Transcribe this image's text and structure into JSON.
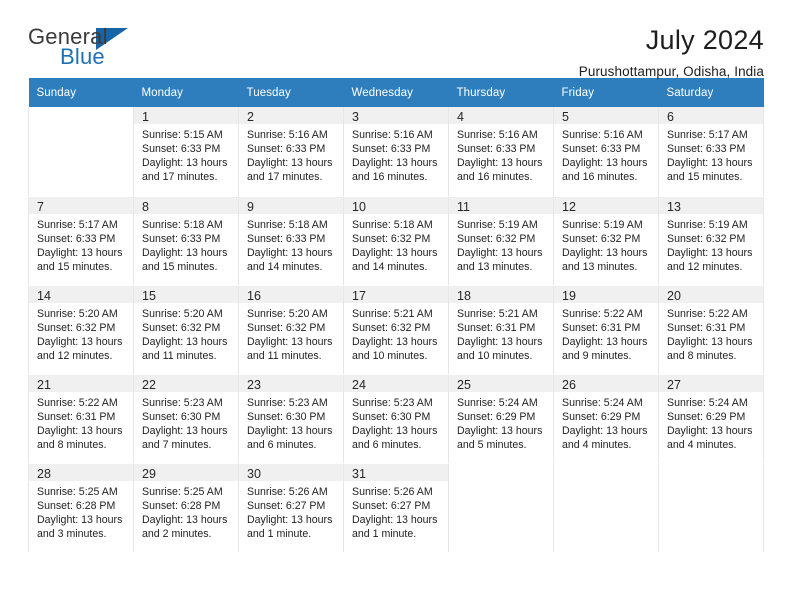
{
  "brand": {
    "word_one": "General",
    "word_two": "Blue",
    "triangle_color": "#1565a8",
    "blue_color": "#1c72b8"
  },
  "header": {
    "title": "July 2024",
    "subtitle": "Purushottampur, Odisha, India",
    "header_bg": "#2e7ebe",
    "header_text_color": "#ffffff"
  },
  "calendar": {
    "weekday_headers": [
      "Sunday",
      "Monday",
      "Tuesday",
      "Wednesday",
      "Thursday",
      "Friday",
      "Saturday"
    ],
    "labels": {
      "sunrise": "Sunrise:",
      "sunset": "Sunset:",
      "daylight": "Daylight:"
    },
    "weeks": [
      [
        {
          "day": "",
          "blank": true
        },
        {
          "day": "1",
          "sunrise": "Sunrise: 5:15 AM",
          "sunset": "Sunset: 6:33 PM",
          "daylight_line1": "Daylight: 13 hours",
          "daylight_line2": "and 17 minutes."
        },
        {
          "day": "2",
          "sunrise": "Sunrise: 5:16 AM",
          "sunset": "Sunset: 6:33 PM",
          "daylight_line1": "Daylight: 13 hours",
          "daylight_line2": "and 17 minutes."
        },
        {
          "day": "3",
          "sunrise": "Sunrise: 5:16 AM",
          "sunset": "Sunset: 6:33 PM",
          "daylight_line1": "Daylight: 13 hours",
          "daylight_line2": "and 16 minutes."
        },
        {
          "day": "4",
          "sunrise": "Sunrise: 5:16 AM",
          "sunset": "Sunset: 6:33 PM",
          "daylight_line1": "Daylight: 13 hours",
          "daylight_line2": "and 16 minutes."
        },
        {
          "day": "5",
          "sunrise": "Sunrise: 5:16 AM",
          "sunset": "Sunset: 6:33 PM",
          "daylight_line1": "Daylight: 13 hours",
          "daylight_line2": "and 16 minutes."
        },
        {
          "day": "6",
          "sunrise": "Sunrise: 5:17 AM",
          "sunset": "Sunset: 6:33 PM",
          "daylight_line1": "Daylight: 13 hours",
          "daylight_line2": "and 15 minutes."
        }
      ],
      [
        {
          "day": "7",
          "sunrise": "Sunrise: 5:17 AM",
          "sunset": "Sunset: 6:33 PM",
          "daylight_line1": "Daylight: 13 hours",
          "daylight_line2": "and 15 minutes."
        },
        {
          "day": "8",
          "sunrise": "Sunrise: 5:18 AM",
          "sunset": "Sunset: 6:33 PM",
          "daylight_line1": "Daylight: 13 hours",
          "daylight_line2": "and 15 minutes."
        },
        {
          "day": "9",
          "sunrise": "Sunrise: 5:18 AM",
          "sunset": "Sunset: 6:33 PM",
          "daylight_line1": "Daylight: 13 hours",
          "daylight_line2": "and 14 minutes."
        },
        {
          "day": "10",
          "sunrise": "Sunrise: 5:18 AM",
          "sunset": "Sunset: 6:32 PM",
          "daylight_line1": "Daylight: 13 hours",
          "daylight_line2": "and 14 minutes."
        },
        {
          "day": "11",
          "sunrise": "Sunrise: 5:19 AM",
          "sunset": "Sunset: 6:32 PM",
          "daylight_line1": "Daylight: 13 hours",
          "daylight_line2": "and 13 minutes."
        },
        {
          "day": "12",
          "sunrise": "Sunrise: 5:19 AM",
          "sunset": "Sunset: 6:32 PM",
          "daylight_line1": "Daylight: 13 hours",
          "daylight_line2": "and 13 minutes."
        },
        {
          "day": "13",
          "sunrise": "Sunrise: 5:19 AM",
          "sunset": "Sunset: 6:32 PM",
          "daylight_line1": "Daylight: 13 hours",
          "daylight_line2": "and 12 minutes."
        }
      ],
      [
        {
          "day": "14",
          "sunrise": "Sunrise: 5:20 AM",
          "sunset": "Sunset: 6:32 PM",
          "daylight_line1": "Daylight: 13 hours",
          "daylight_line2": "and 12 minutes."
        },
        {
          "day": "15",
          "sunrise": "Sunrise: 5:20 AM",
          "sunset": "Sunset: 6:32 PM",
          "daylight_line1": "Daylight: 13 hours",
          "daylight_line2": "and 11 minutes."
        },
        {
          "day": "16",
          "sunrise": "Sunrise: 5:20 AM",
          "sunset": "Sunset: 6:32 PM",
          "daylight_line1": "Daylight: 13 hours",
          "daylight_line2": "and 11 minutes."
        },
        {
          "day": "17",
          "sunrise": "Sunrise: 5:21 AM",
          "sunset": "Sunset: 6:32 PM",
          "daylight_line1": "Daylight: 13 hours",
          "daylight_line2": "and 10 minutes."
        },
        {
          "day": "18",
          "sunrise": "Sunrise: 5:21 AM",
          "sunset": "Sunset: 6:31 PM",
          "daylight_line1": "Daylight: 13 hours",
          "daylight_line2": "and 10 minutes."
        },
        {
          "day": "19",
          "sunrise": "Sunrise: 5:22 AM",
          "sunset": "Sunset: 6:31 PM",
          "daylight_line1": "Daylight: 13 hours",
          "daylight_line2": "and 9 minutes."
        },
        {
          "day": "20",
          "sunrise": "Sunrise: 5:22 AM",
          "sunset": "Sunset: 6:31 PM",
          "daylight_line1": "Daylight: 13 hours",
          "daylight_line2": "and 8 minutes."
        }
      ],
      [
        {
          "day": "21",
          "sunrise": "Sunrise: 5:22 AM",
          "sunset": "Sunset: 6:31 PM",
          "daylight_line1": "Daylight: 13 hours",
          "daylight_line2": "and 8 minutes."
        },
        {
          "day": "22",
          "sunrise": "Sunrise: 5:23 AM",
          "sunset": "Sunset: 6:30 PM",
          "daylight_line1": "Daylight: 13 hours",
          "daylight_line2": "and 7 minutes."
        },
        {
          "day": "23",
          "sunrise": "Sunrise: 5:23 AM",
          "sunset": "Sunset: 6:30 PM",
          "daylight_line1": "Daylight: 13 hours",
          "daylight_line2": "and 6 minutes."
        },
        {
          "day": "24",
          "sunrise": "Sunrise: 5:23 AM",
          "sunset": "Sunset: 6:30 PM",
          "daylight_line1": "Daylight: 13 hours",
          "daylight_line2": "and 6 minutes."
        },
        {
          "day": "25",
          "sunrise": "Sunrise: 5:24 AM",
          "sunset": "Sunset: 6:29 PM",
          "daylight_line1": "Daylight: 13 hours",
          "daylight_line2": "and 5 minutes."
        },
        {
          "day": "26",
          "sunrise": "Sunrise: 5:24 AM",
          "sunset": "Sunset: 6:29 PM",
          "daylight_line1": "Daylight: 13 hours",
          "daylight_line2": "and 4 minutes."
        },
        {
          "day": "27",
          "sunrise": "Sunrise: 5:24 AM",
          "sunset": "Sunset: 6:29 PM",
          "daylight_line1": "Daylight: 13 hours",
          "daylight_line2": "and 4 minutes."
        }
      ],
      [
        {
          "day": "28",
          "sunrise": "Sunrise: 5:25 AM",
          "sunset": "Sunset: 6:28 PM",
          "daylight_line1": "Daylight: 13 hours",
          "daylight_line2": "and 3 minutes."
        },
        {
          "day": "29",
          "sunrise": "Sunrise: 5:25 AM",
          "sunset": "Sunset: 6:28 PM",
          "daylight_line1": "Daylight: 13 hours",
          "daylight_line2": "and 2 minutes."
        },
        {
          "day": "30",
          "sunrise": "Sunrise: 5:26 AM",
          "sunset": "Sunset: 6:27 PM",
          "daylight_line1": "Daylight: 13 hours",
          "daylight_line2": "and 1 minute."
        },
        {
          "day": "31",
          "sunrise": "Sunrise: 5:26 AM",
          "sunset": "Sunset: 6:27 PM",
          "daylight_line1": "Daylight: 13 hours",
          "daylight_line2": "and 1 minute."
        },
        {
          "day": "",
          "blank": true
        },
        {
          "day": "",
          "blank": true
        },
        {
          "day": "",
          "blank": true
        }
      ]
    ]
  }
}
